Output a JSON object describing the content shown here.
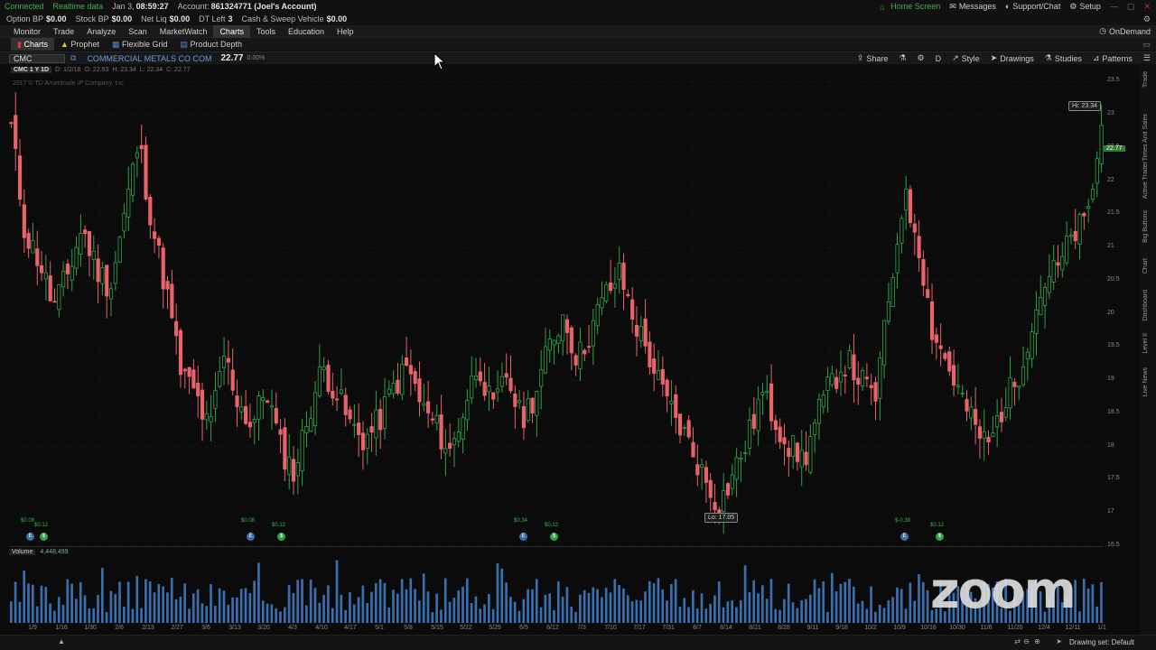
{
  "status": {
    "connected": "Connected",
    "realtime": "Realtime data",
    "date": "Jan 3,",
    "time": "08:59:27",
    "account_label": "Account:",
    "account_value": "861324771 (Joel's Account)"
  },
  "top_right": {
    "home": "Home Screen",
    "messages": "Messages",
    "support": "Support/Chat",
    "setup": "Setup"
  },
  "balances": [
    {
      "label": "Option BP",
      "value": "$0.00"
    },
    {
      "label": "Stock BP",
      "value": "$0.00"
    },
    {
      "label": "Net Liq",
      "value": "$0.00"
    },
    {
      "label": "DT Left",
      "value": "3"
    },
    {
      "label": "Cash & Sweep Vehicle",
      "value": "$0.00"
    }
  ],
  "menu": [
    "Monitor",
    "Trade",
    "Analyze",
    "Scan",
    "MarketWatch",
    "Charts",
    "Tools",
    "Education",
    "Help"
  ],
  "menu_active": "Charts",
  "ondemand": "OnDemand",
  "subtabs": [
    "Charts",
    "Prophet",
    "Flexible Grid",
    "Product Depth"
  ],
  "chart_header": {
    "symbol": "CMC",
    "company": "COMMERCIAL METALS CO COM",
    "price": "22.77",
    "change": "0.00%",
    "buttons": [
      "Share",
      "Style",
      "Drawings",
      "Studies",
      "Patterns"
    ],
    "d_label": "D"
  },
  "chart_info": {
    "symbol_period": "CMC 1 Y 1D",
    "d": "D: 1/2/18",
    "o": "O: 22.63",
    "h": "H: 23.34",
    "l": "L: 22.34",
    "c": "C: 22.77",
    "copyright": "2017 © TD Ameritrade IP Company, Inc."
  },
  "hi_label": "Hi: 23.34",
  "lo_label": "Lo: 17.05",
  "last_price": "22.77",
  "volume": {
    "title": "Volume",
    "value": "4,448,499",
    "unit": "millions"
  },
  "sidebar_tabs": [
    "Trade",
    "Times And Sales",
    "Active Trader",
    "Big Buttons",
    "Chart",
    "Dashboard",
    "Level II",
    "Live News"
  ],
  "drawing_set": "Drawing set: Default",
  "zoom_logo": "zoom",
  "event_labels": [
    "$0.08",
    "$0.12",
    "$0.08",
    "$0.12",
    "$0.34",
    "$0.12",
    "$-0.38",
    "$0.12"
  ],
  "chart_data": {
    "type": "candlestick",
    "y_range": [
      16.5,
      23.6
    ],
    "y_ticks": [
      "23.5",
      "23",
      "22.5",
      "22",
      "21.5",
      "21",
      "20.5",
      "20",
      "19.5",
      "19",
      "18.5",
      "18",
      "17.5",
      "17",
      "16.5"
    ],
    "x_ticks": [
      "1/9",
      "1/16",
      "1/30",
      "2/6",
      "2/13",
      "2/27",
      "3/6",
      "3/13",
      "3/20",
      "4/3",
      "4/10",
      "4/17",
      "5/1",
      "5/8",
      "5/15",
      "5/22",
      "5/29",
      "6/5",
      "6/12",
      "7/3",
      "7/10",
      "7/17",
      "7/31",
      "8/7",
      "8/14",
      "8/21",
      "8/28",
      "9/11",
      "9/18",
      "10/2",
      "10/9",
      "10/16",
      "10/30",
      "11/6",
      "11/20",
      "12/4",
      "12/11",
      "1/1"
    ],
    "close_path": [
      22.8,
      21.2,
      20.8,
      20.1,
      20.6,
      21.3,
      20.7,
      20.4,
      21.5,
      22.6,
      21.3,
      20.3,
      19.1,
      18.8,
      18.2,
      19.4,
      18.7,
      18.3,
      18.9,
      18.0,
      17.6,
      18.5,
      19.2,
      18.8,
      18.3,
      18.1,
      18.4,
      18.9,
      19.2,
      18.6,
      18.3,
      17.9,
      18.6,
      19.3,
      18.5,
      19.1,
      18.4,
      18.8,
      19.5,
      20.0,
      19.3,
      19.8,
      20.3,
      20.6,
      19.9,
      19.4,
      18.8,
      18.4,
      18.0,
      17.5,
      17.1,
      17.6,
      18.1,
      18.8,
      18.4,
      18.0,
      17.8,
      18.5,
      19.0,
      19.3,
      19.0,
      18.7,
      20.2,
      21.8,
      21.2,
      19.8,
      19.3,
      18.8,
      18.3,
      18.0,
      18.6,
      19.0,
      19.8,
      20.5,
      20.7,
      21.2,
      21.4,
      22.8
    ],
    "volume_range": [
      0,
      1
    ]
  }
}
